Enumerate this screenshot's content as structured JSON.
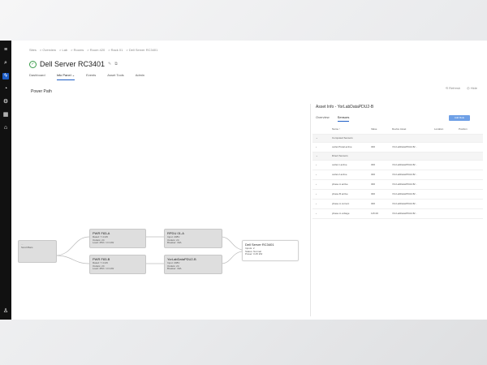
{
  "page": {
    "breadcrumbs": [
      "Sites",
      "Overview",
      "Lab",
      "Rooms",
      "Room 420",
      "Rack 01",
      "Dell Server RC3401"
    ],
    "title": "Dell Server RC3401",
    "tabs": [
      "Dashboard",
      "Info Panel ⌄",
      "Events",
      "Asset Tools",
      "Admin"
    ],
    "selected_tab": 1,
    "section_title": "Power Path",
    "actions": [
      "⟲ Refresh",
      "◎ Hide"
    ]
  },
  "nodes": [
    {
      "id": "n0",
      "title": "",
      "lines": [
        "...",
        "Scroll Bars"
      ]
    },
    {
      "id": "n1",
      "title": "PWR F83-A",
      "lines": [
        "Rated: 7.4 kW",
        "Outlets: 24",
        "Load: 45% / 3.3 kW"
      ]
    },
    {
      "id": "n2",
      "title": "PWR F83-B",
      "lines": [
        "Rated: 7.4 kW",
        "Outlets: 24",
        "Load: 45% / 3.3 kW"
      ]
    },
    {
      "id": "n3",
      "title": "RPDU 01-A",
      "lines": [
        "Input: 208V",
        "Outlets: 24",
        "Breaker: 30A"
      ]
    },
    {
      "id": "n4",
      "title": "YorLabDataPDU2-B",
      "lines": [
        "Input: 208V",
        "Outlets: 24",
        "Breaker: 30A"
      ]
    },
    {
      "id": "n5",
      "title": "Dell Server RC3401",
      "lines": [
        "Inputs: 2",
        "Status: Normal",
        "Power: 0.45 kW"
      ]
    }
  ],
  "panel": {
    "title": "Asset Info - YorLabDataPDU2-B",
    "tabs": [
      "Overview",
      "Sensors"
    ],
    "selected_tab": 1,
    "add_button": "Add Rule",
    "headers": [
      "Name ↑",
      "Value",
      "Device Asset",
      "Location",
      "Position"
    ],
    "rows": [
      {
        "group": "Computed Sensors"
      },
      {
        "name": "outlet.Ptotal.active",
        "value": "300",
        "asset": "/YorLabDataPDU2-B/..."
      },
      {
        "group": "Direct Sensors"
      },
      {
        "name": "outlet.1.active",
        "value": "300",
        "asset": "/YorLabDataPDU2-B/..."
      },
      {
        "name": "outlet.2.active",
        "value": "300",
        "asset": "/YorLabDataPDU2-B/..."
      },
      {
        "name": "phase.A.active",
        "value": "300",
        "asset": "/YorLabDataPDU2-B/..."
      },
      {
        "name": "phase.B.active",
        "value": "300",
        "asset": "/YorLabDataPDU2-B/..."
      },
      {
        "name": "phase.A.current",
        "value": "300",
        "asset": "/YorLabDataPDU2-B/..."
      },
      {
        "name": "phase.A.voltage",
        "value": "115.00",
        "asset": "/YorLabDataPDU2-B/..."
      }
    ]
  },
  "rail_icons": [
    "menu-icon",
    "search-icon",
    "power-icon",
    "alert-icon",
    "gear-icon",
    "grid-icon",
    "monitor-icon",
    "user-icon"
  ]
}
